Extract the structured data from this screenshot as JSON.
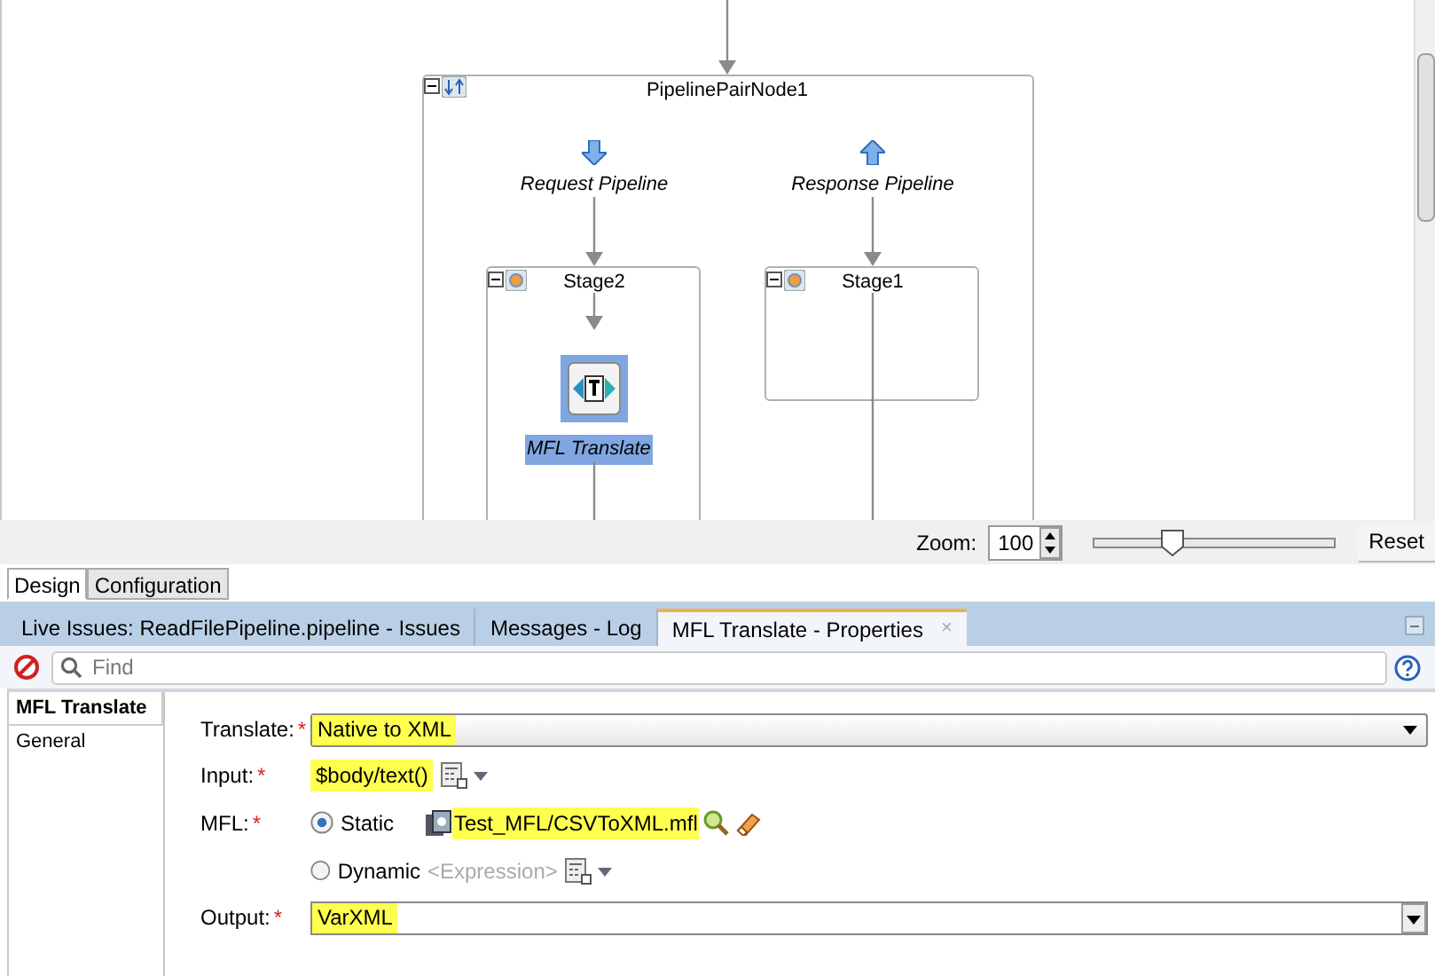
{
  "canvas": {
    "container": {
      "title": "PipelinePairNode1"
    },
    "pipelines": [
      {
        "kind": "request",
        "label": "Request Pipeline",
        "stage": "Stage2"
      },
      {
        "kind": "response",
        "label": "Response Pipeline",
        "stage": "Stage1"
      }
    ],
    "action": {
      "label": "MFL Translate",
      "selected": true
    }
  },
  "zoom_bar": {
    "label": "Zoom:",
    "value": "100",
    "slider": {
      "level": 0.33
    },
    "reset": "Reset"
  },
  "editor_tabs": [
    {
      "label": "Design",
      "selected": true
    },
    {
      "label": "Configuration",
      "selected": false
    }
  ],
  "panel_tabs": [
    {
      "label": "Live Issues: ReadFilePipeline.pipeline - Issues",
      "selected": false
    },
    {
      "label": "Messages - Log",
      "selected": false
    },
    {
      "label": "MFL Translate - Properties",
      "selected": true,
      "close": "×"
    }
  ],
  "search": {
    "placeholder": "Find"
  },
  "nav": [
    {
      "label": "MFL Translate",
      "selected": true
    },
    {
      "label": "General",
      "selected": false
    }
  ],
  "form": {
    "translate": {
      "label": "Translate:",
      "mark": "*",
      "value": "Native to XML",
      "highlighted": true
    },
    "input": {
      "label": "Input:",
      "mark": "*",
      "value": "$body/text()",
      "highlighted": true
    },
    "mfl": {
      "label": "MFL:",
      "mark": "*",
      "options": [
        {
          "label": "Static",
          "selected": true,
          "value": "Test_MFL/CSVToXML.mfl",
          "highlighted": true
        },
        {
          "label": "Dynamic",
          "selected": false,
          "placeholder": "<Expression>"
        }
      ]
    },
    "output": {
      "label": "Output:",
      "mark": "*",
      "value": "VarXML",
      "highlighted": true
    }
  }
}
